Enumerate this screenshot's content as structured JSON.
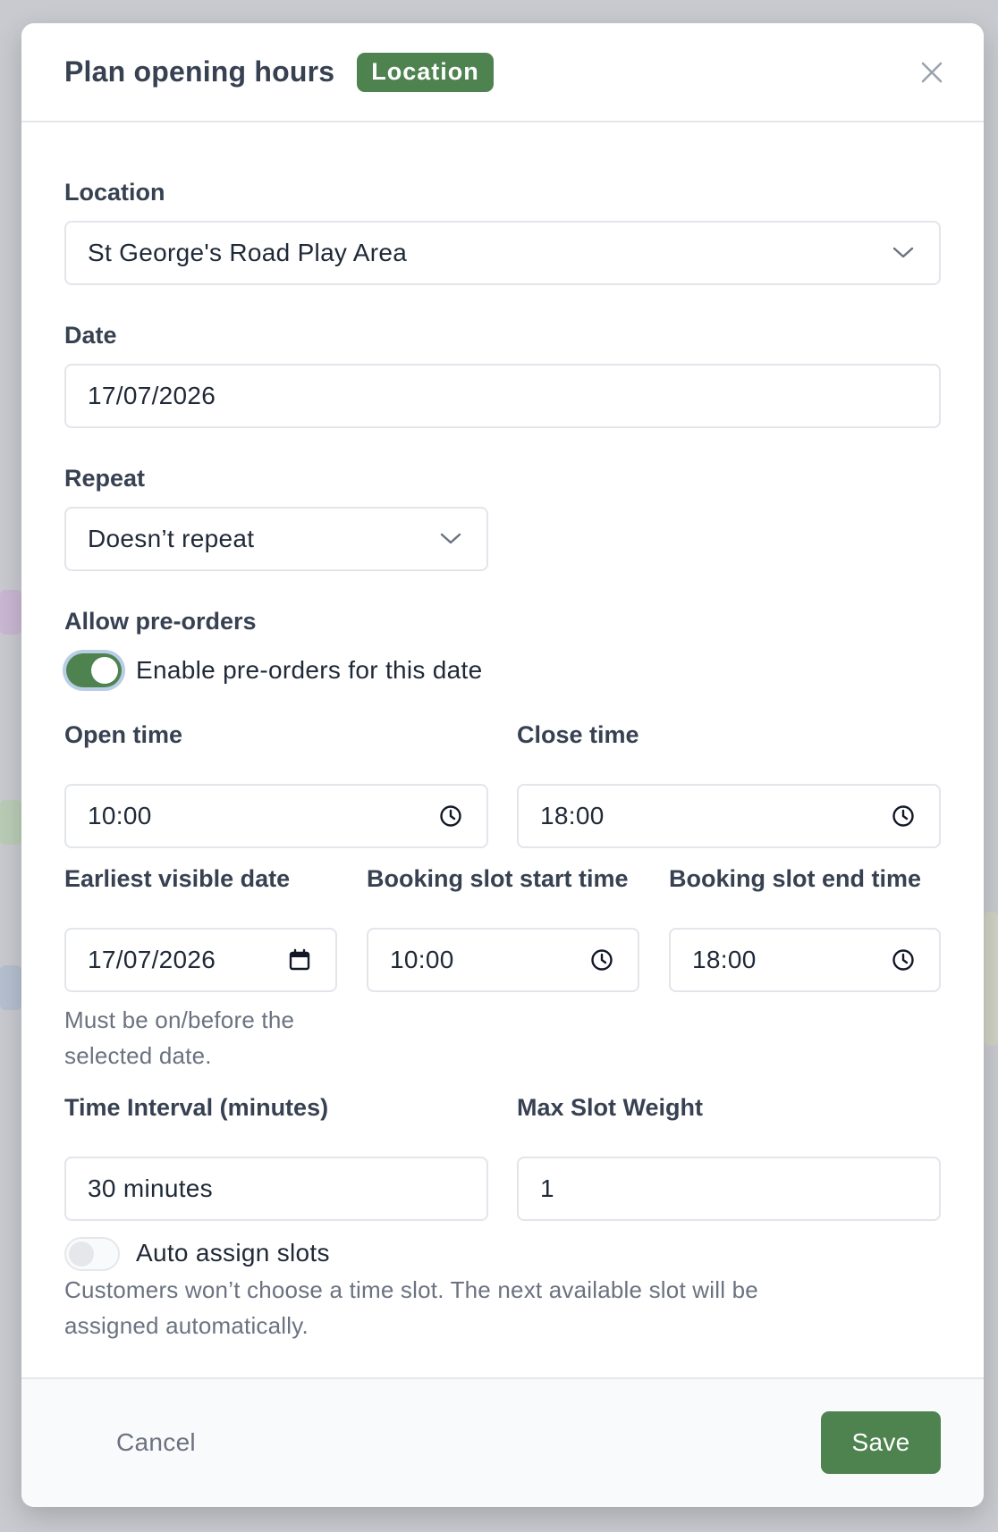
{
  "modal": {
    "title": "Plan opening hours",
    "badge": "Location"
  },
  "fields": {
    "location": {
      "label": "Location",
      "value": "St George's Road Play Area"
    },
    "date": {
      "label": "Date",
      "value": "17/07/2026"
    },
    "repeat": {
      "label": "Repeat",
      "value": "Doesn’t repeat"
    },
    "preorders": {
      "label": "Allow pre-orders",
      "toggle_text": "Enable pre-orders for this date",
      "enabled": true
    },
    "open_time": {
      "label": "Open time",
      "value": "10:00"
    },
    "close_time": {
      "label": "Close time",
      "value": "18:00"
    },
    "earliest_visible": {
      "label": "Earliest visible date",
      "value": "17/07/2026",
      "help_line1": "Must be on/before the",
      "help_line2": "selected date."
    },
    "slot_start": {
      "label": "Booking slot start time",
      "value": "10:00"
    },
    "slot_end": {
      "label": "Booking slot end time",
      "value": "18:00"
    },
    "interval": {
      "label": "Time Interval (minutes)",
      "value": "30 minutes"
    },
    "max_weight": {
      "label": "Max Slot Weight",
      "value": "1"
    },
    "auto_assign": {
      "label": "Auto assign slots",
      "enabled": false,
      "help_line1": "Customers won’t choose a time slot. The next available slot will be",
      "help_line2": "assigned automatically."
    }
  },
  "footer": {
    "cancel_label": "Cancel",
    "save_label": "Save"
  },
  "colors": {
    "accent": "#4e8350",
    "focus_ring": "#b9cde7"
  }
}
